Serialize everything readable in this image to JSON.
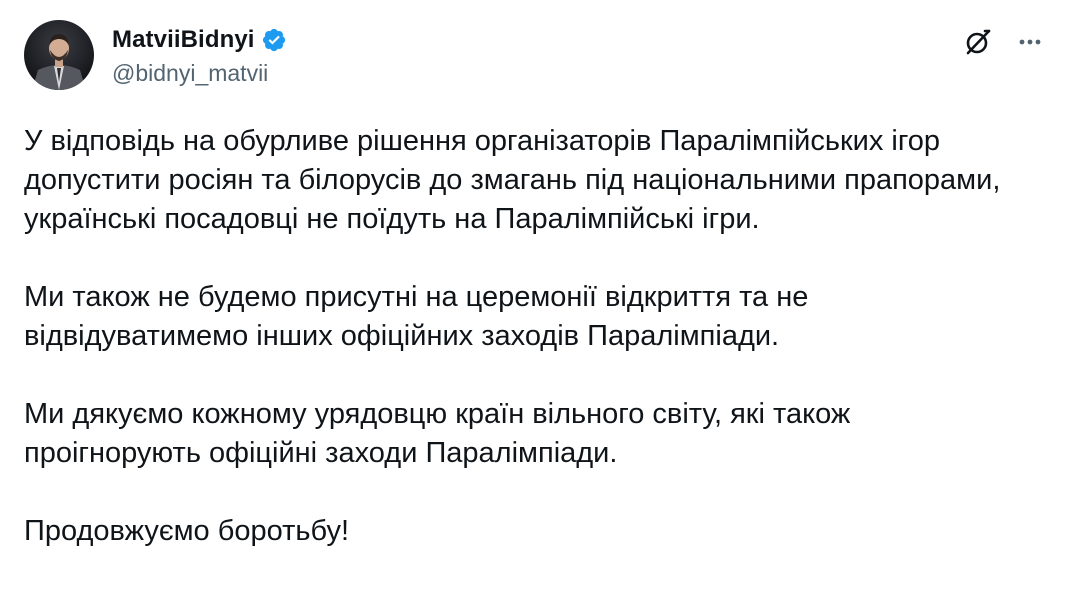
{
  "author": {
    "display_name": "MatviiBidnyi",
    "handle": "@bidnyi_matvii",
    "verified": true
  },
  "icons": {
    "avatar": "profile-photo",
    "verified": "verified-badge-icon",
    "grok": "grok-icon",
    "more": "more-options-icon"
  },
  "colors": {
    "verified": "#1d9bf0",
    "text": "#0f1419",
    "secondary": "#536471"
  },
  "tweet": {
    "paragraphs": [
      "У відповідь на обурливе рішення організаторів Паралімпійських ігор\nдопустити росіян та білорусів до змагань під національними прапорами,\nукраїнські посадовці не поїдуть на Паралімпійські ігри.",
      "Ми також не будемо присутні на церемонії відкриття та не\nвідвідуватимемо інших офіційних заходів Паралімпіади.",
      "Ми дякуємо кожному урядовцю країн вільного світу, які також\nпроігнорують офіційні заходи Паралімпіади.",
      "Продовжуємо боротьбу!"
    ]
  }
}
